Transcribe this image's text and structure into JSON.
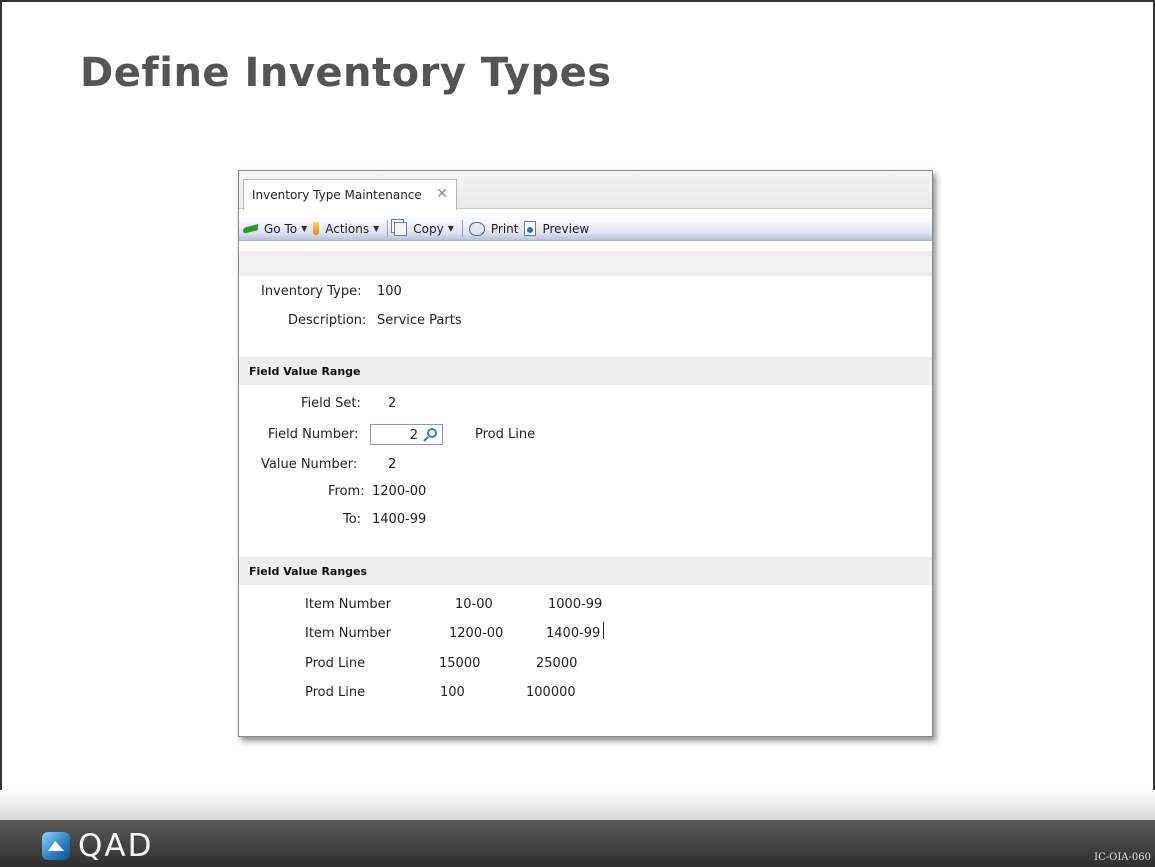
{
  "slide": {
    "title": "Define Inventory Types",
    "code": "IC-OIA-060"
  },
  "window": {
    "tab_label": "Inventory Type Maintenance",
    "tab_close_glyph": "✕",
    "toolbar": {
      "goto_label": "Go To",
      "actions_label": "Actions",
      "copy_label": "Copy",
      "print_label": "Print",
      "preview_label": "Preview",
      "dropdown_glyph": "▼"
    },
    "header_fields": {
      "inventory_type_label": "Inventory Type:",
      "inventory_type_value": "100",
      "description_label": "Description:",
      "description_value": "Service Parts"
    },
    "field_value_range": {
      "section_title": "Field Value Range",
      "field_set_label": "Field Set:",
      "field_set_value": "2",
      "field_number_label": "Field Number:",
      "field_number_value": "2",
      "field_name": "Prod Line",
      "value_number_label": "Value Number:",
      "value_number_value": "2",
      "from_label": "From:",
      "from_value": "1200-00",
      "to_label": "To:",
      "to_value": "1400-99"
    },
    "field_value_ranges": {
      "section_title": "Field Value Ranges",
      "rows": [
        {
          "field": "Item Number",
          "from": "10-00",
          "to": "1000-99"
        },
        {
          "field": "Item Number",
          "from": "1200-00",
          "to": "1400-99"
        },
        {
          "field": "Prod Line",
          "from": "15000",
          "to": "25000"
        },
        {
          "field": "Prod Line",
          "from": "100",
          "to": "100000"
        }
      ]
    }
  },
  "footer": {
    "logo_text": "QAD"
  },
  "colors": {
    "title": "#545454",
    "footer": "#3a3a3a",
    "accent_icon": "#3a82c8"
  }
}
